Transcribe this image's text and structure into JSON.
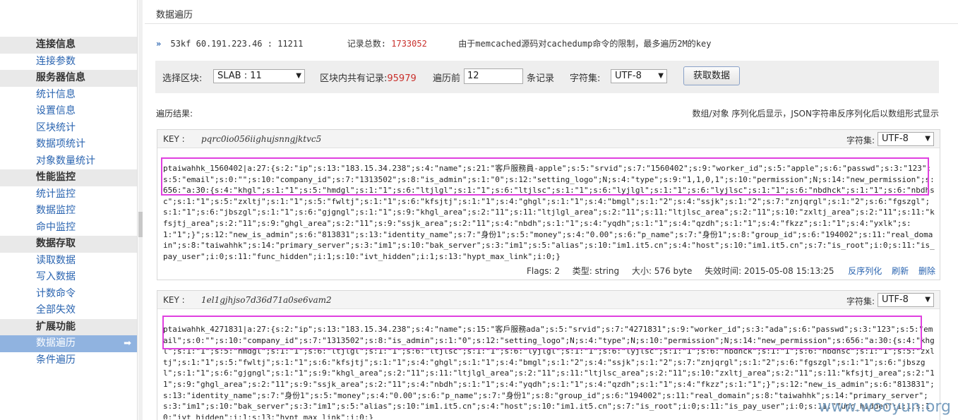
{
  "sidebar": {
    "sections": [
      {
        "header": "连接信息",
        "items": [
          "连接参数"
        ]
      },
      {
        "header": "服务器信息",
        "items": [
          "统计信息",
          "设置信息",
          "区块统计",
          "数据项统计",
          "对象数量统计"
        ]
      },
      {
        "header": "性能监控",
        "items": [
          "统计监控",
          "数据监控",
          "命中监控"
        ]
      },
      {
        "header": "数据存取",
        "items": [
          "读取数据",
          "写入数据",
          "计数命令",
          "全部失效"
        ]
      },
      {
        "header": "扩展功能",
        "items": [
          "数据遍历",
          "条件遍历"
        ]
      }
    ],
    "active_item": "数据遍历",
    "active_arrow": "➡"
  },
  "page": {
    "title": "数据遍历",
    "server_chev": "»",
    "server": "53kf  60.191.223.46 : 11211",
    "total_label": "记录总数:",
    "total_value": "1733052",
    "note": "由于memcached源码对cachedump命令的限制，最多遍历2M的key"
  },
  "filter": {
    "slab_label": "选择区块:",
    "slab_value": "SLAB : 11",
    "block_count_label": "区块内共有记录:",
    "block_count_value": "95979",
    "traverse_label": "遍历前",
    "traverse_value": "12",
    "records_label": "条记录",
    "charset_label": "字符集:",
    "charset_value": "UTF-8",
    "fetch_button": "获取数据"
  },
  "results": {
    "label": "遍历结果:",
    "note": "数组/对象 序列化后显示，JSON字符串反序列化后以数组形式显示"
  },
  "records": [
    {
      "key_label": "KEY :",
      "key": "pqrc0io056iighujsnngjktvc5",
      "charset_label": "字符集:",
      "charset": "UTF-8",
      "content": "ptaiwahhk_1560402|a:27:{s:2:\"ip\";s:13:\"183.15.34.238\";s:4:\"name\";s:21:\"客戶服務員-apple\";s:5:\"srvid\";s:7:\"1560402\";s:9:\"worker_id\";s:5:\"apple\";s:6:\"passwd\";s:3:\"123\";s:5:\"email\";s:0:\"\";s:10:\"company_id\";s:7:\"1313502\";s:8:\"is_admin\";s:1:\"0\";s:12:\"setting_logo\";N;s:4:\"type\";s:9:\"1,1,0,1\";s:10:\"permission\";N;s:14:\"new_permission\";s:656:\"a:30:{s:4:\"khgl\";s:1:\"1\";s:5:\"hmdgl\";s:1:\"1\";s:6:\"ltjlgl\";s:1:\"1\";s:6:\"ltjlsc\";s:1:\"1\";s:6:\"lyjlgl\";s:1:\"1\";s:6:\"lyjlsc\";s:1:\"1\";s:6:\"nbdhck\";s:1:\"1\";s:6:\"nbdhsc\";s:1:\"1\";s:5:\"zxltj\";s:1:\"1\";s:5:\"fwltj\";s:1:\"1\";s:6:\"kfsjtj\";s:1:\"1\";s:4:\"ghgl\";s:1:\"1\";s:4:\"bmgl\";s:1:\"2\";s:4:\"ssjk\";s:1:\"2\";s:7:\"znjqrgl\";s:1:\"2\";s:6:\"fgszgl\";s:1:\"1\";s:6:\"jbszgl\";s:1:\"1\";s:6:\"gjgngl\";s:1:\"1\";s:9:\"khgl_area\";s:2:\"11\";s:11:\"ltjlgl_area\";s:2:\"11\";s:11:\"ltjlsc_area\";s:2:\"11\";s:10:\"zxltj_area\";s:2:\"11\";s:11:\"kfsjtj_area\";s:2:\"11\";s:9:\"ghgl_area\";s:2:\"11\";s:9:\"ssjk_area\";s:2:\"11\";s:4:\"nbdh\";s:1:\"1\";s:4:\"yqdh\";s:1:\"1\";s:4:\"qzdh\";s:1:\"1\";s:4:\"fkzz\";s:1:\"1\";s:4:\"yxlk\";s:1:\"1\";}\";s:12:\"new_is_admin\";s:6:\"813831\";s:13:\"identity_name\";s:7:\"身份1\";s:5:\"money\";s:4:\"0.00\";s:6:\"p_name\";s:7:\"身份1\";s:8:\"group_id\";s:6:\"194002\";s:11:\"real_domain\";s:8:\"taiwahhk\";s:14:\"primary_server\";s:3:\"im1\";s:10:\"bak_server\";s:3:\"im1\";s:5:\"alias\";s:10:\"im1.it5.cn\";s:4:\"host\";s:10:\"im1.it5.cn\";s:7:\"is_root\";i:0;s:11:\"is_pay_user\";i:0;s:11:\"func_hidden\";i:1;s:10:\"ivt_hidden\";i:1;s:13:\"hypt_max_link\";i:0;}",
      "flags": "Flags: 2",
      "type": "类型: string",
      "size": "大小: 576  byte",
      "expire": "失效时间: 2015-05-08 15:13:25",
      "action_unserialize": "反序列化",
      "action_refresh": "刷新",
      "action_delete": "删除"
    },
    {
      "key_label": "KEY :",
      "key": "1el1gjhjso7d36d71a0se6vam2",
      "charset_label": "字符集:",
      "charset": "UTF-8",
      "content": "ptaiwahhk_4271831|a:27:{s:2:\"ip\";s:13:\"183.15.34.238\";s:4:\"name\";s:15:\"客戶服務ada\";s:5:\"srvid\";s:7:\"4271831\";s:9:\"worker_id\";s:3:\"ada\";s:6:\"passwd\";s:3:\"123\";s:5:\"email\";s:0:\"\";s:10:\"company_id\";s:7:\"1313502\";s:8:\"is_admin\";s:1:\"0\";s:12:\"setting_logo\";N;s:4:\"type\";N;s:10:\"permission\";N;s:14:\"new_permission\";s:656:\"a:30:{s:4:\"khgl\";s:1:\"1\";s:5:\"hmdgl\";s:1:\"1\";s:6:\"ltjlgl\";s:1:\"1\";s:6:\"ltjlsc\";s:1:\"1\";s:6:\"lyjlgl\";s:1:\"1\";s:6:\"lyjlsc\";s:1:\"1\";s:6:\"nbdhck\";s:1:\"1\";s:6:\"nbdhsc\";s:1:\"1\";s:5:\"zxltj\";s:1:\"1\";s:5:\"fwltj\";s:1:\"1\";s:6:\"kfsjtj\";s:1:\"1\";s:4:\"ghgl\";s:1:\"1\";s:4:\"bmgl\";s:1:\"2\";s:4:\"ssjk\";s:1:\"2\";s:7:\"znjqrgl\";s:1:\"2\";s:6:\"fgszgl\";s:1:\"1\";s:6:\"jbszgl\";s:1:\"1\";s:6:\"gjgngl\";s:1:\"1\";s:9:\"khgl_area\";s:2:\"11\";s:11:\"ltjlgl_area\";s:2:\"11\";s:11:\"ltjlsc_area\";s:2:\"11\";s:10:\"zxltj_area\";s:2:\"11\";s:11:\"kfsjtj_area\";s:2:\"11\";s:9:\"ghgl_area\";s:2:\"11\";s:9:\"ssjk_area\";s:2:\"11\";s:4:\"nbdh\";s:1:\"1\";s:4:\"yqdh\";s:1:\"1\";s:4:\"qzdh\";s:1:\"1\";s:4:\"fkzz\";s:1:\"1\";}\";s:12:\"new_is_admin\";s:6:\"813831\";s:13:\"identity_name\";s:7:\"身份1\";s:5:\"money\";s:4:\"0.00\";s:6:\"p_name\";s:7:\"身份1\";s:8:\"group_id\";s:6:\"194002\";s:11:\"real_domain\";s:8:\"taiwahhk\";s:14:\"primary_server\";s:3:\"im1\";s:10:\"bak_server\";s:3:\"im1\";s:5:\"alias\";s:10:\"im1.it5.cn\";s:4:\"host\";s:10:\"im1.it5.cn\";s:7:\"is_root\";i:0;s:11:\"is_pay_user\";i:0;s:11:\"func_hidden\";i:1;s:10:\"ivt_hidden\";i:1;s:13:\"hypt_max_link\";i:0;}"
    }
  ],
  "watermark": "www.wooyun.org"
}
